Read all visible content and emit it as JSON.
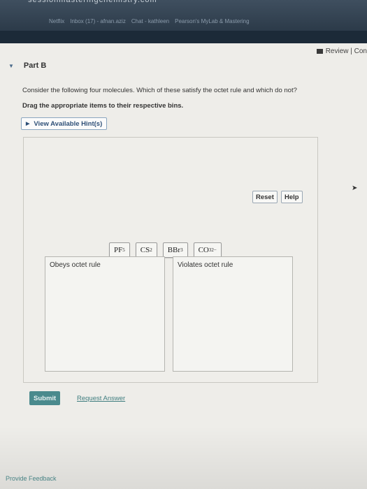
{
  "browser": {
    "url": "sessionmasteringchemistry.com",
    "bookmarks": [
      "Netflix",
      "Inbox (17) - afnan.aziz",
      "Chat - kathleen",
      "Pearson's MyLab & Mastering"
    ]
  },
  "header": {
    "review_label": "Review | Con"
  },
  "part": {
    "title": "Part B"
  },
  "question": {
    "prompt": "Consider the following four molecules. Which of these satisfy the octet rule and which do not?",
    "instruction": "Drag the appropriate items to their respective bins."
  },
  "hint": {
    "label": "View Available Hint(s)"
  },
  "controls": {
    "reset_label": "Reset",
    "help_label": "Help"
  },
  "tiles": [
    {
      "base": "PF",
      "sub": "5",
      "sup": ""
    },
    {
      "base": "CS",
      "sub": "2",
      "sup": ""
    },
    {
      "base": "BBr",
      "sub": "3",
      "sup": ""
    },
    {
      "base": "CO",
      "sub": "3",
      "sup": "2−"
    }
  ],
  "bins": {
    "left_label": "Obeys octet rule",
    "right_label": "Violates octet rule"
  },
  "footer": {
    "submit_label": "Submit",
    "request_label": "Request Answer",
    "feedback_label": "Provide Feedback"
  },
  "colors": {
    "accent": "#4a8a8d",
    "link": "#2e4f77"
  }
}
